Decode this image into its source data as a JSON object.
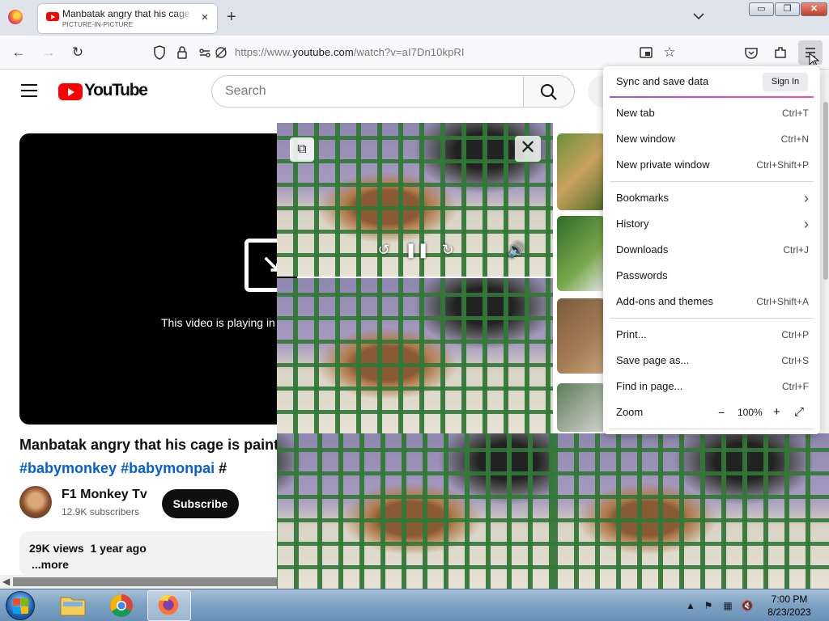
{
  "browser": {
    "tab": {
      "title": "Manbatak angry that his cage is painted",
      "subtitle": "PICTURE-IN-PICTURE",
      "close": "×"
    },
    "new_tab": "+",
    "url_prefix": "https://www.",
    "url_domain": "youtube.com",
    "url_path": "/watch?v=aI7Dn10kpRI"
  },
  "window_controls": {
    "minimize": "▭",
    "restore": "❐",
    "close": "✕"
  },
  "youtube": {
    "logo_text": "YouTube",
    "search_placeholder": "Search",
    "player_message": "This video is playing in Picture-in-Picture",
    "video_title": "Manbatak angry that his cage is painted",
    "hashtags": [
      "#babymonkey",
      "#babymonpai",
      "#"
    ],
    "channel": {
      "name": "F1 Monkey Tv",
      "subscribers": "12.9K subscribers"
    },
    "subscribe_label": "Subscribe",
    "views": "29K views",
    "age": "1 year ago",
    "more": "...more"
  },
  "menu": {
    "sync_label": "Sync and save data",
    "signin_label": "Sign In",
    "groups": [
      [
        {
          "label": "New tab",
          "shortcut": "Ctrl+T"
        },
        {
          "label": "New window",
          "shortcut": "Ctrl+N"
        },
        {
          "label": "New private window",
          "shortcut": "Ctrl+Shift+P"
        }
      ],
      [
        {
          "label": "Bookmarks",
          "shortcut": "›"
        },
        {
          "label": "History",
          "shortcut": "›"
        },
        {
          "label": "Downloads",
          "shortcut": "Ctrl+J"
        },
        {
          "label": "Passwords",
          "shortcut": ""
        },
        {
          "label": "Add-ons and themes",
          "shortcut": "Ctrl+Shift+A"
        }
      ],
      [
        {
          "label": "Print...",
          "shortcut": "Ctrl+P"
        },
        {
          "label": "Save page as...",
          "shortcut": "Ctrl+S"
        },
        {
          "label": "Find in page...",
          "shortcut": "Ctrl+F"
        }
      ]
    ],
    "zoom": {
      "label": "Zoom",
      "minus": "−",
      "value": "100%",
      "plus": "+",
      "fullscreen": "⤢"
    }
  },
  "pip": {
    "back": "⧉",
    "close": "✕",
    "rewind": "↺",
    "pause": "❚❚",
    "forward": "↻",
    "volume": "🔊"
  },
  "taskbar": {
    "time": "7:00 PM",
    "date": "8/23/2023"
  },
  "colors": {
    "accent": "#065fd4",
    "yt_red": "#ff0000",
    "taskbar": "#7fa3c4"
  }
}
